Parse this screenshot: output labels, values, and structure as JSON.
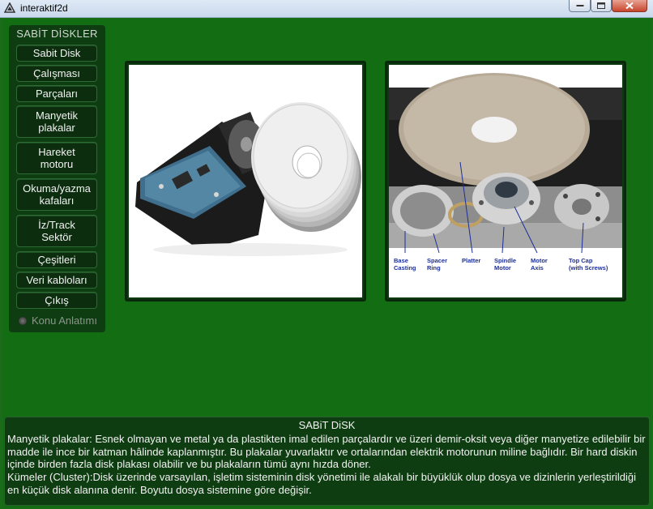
{
  "window": {
    "title": "interaktif2d"
  },
  "sidebar": {
    "title": "SABİT DİSKLER",
    "items": [
      {
        "label": "Sabit Disk"
      },
      {
        "label": "Çalışması"
      },
      {
        "label": "Parçaları"
      },
      {
        "label": "Manyetik\nplakalar"
      },
      {
        "label": "Hareket\nmotoru"
      },
      {
        "label": "Okuma/yazma\nkafaları"
      },
      {
        "label": "İz/Track\nSektör"
      },
      {
        "label": "Çeşitleri"
      },
      {
        "label": "Veri kabloları"
      },
      {
        "label": "Çıkış"
      }
    ],
    "radio_label": "Konu Anlatımı"
  },
  "right_image": {
    "labels": [
      "Base\nCasting",
      "Spacer\nRing",
      "Platter",
      "Spindle\nMotor",
      "Motor\nAxis",
      "Top Cap\n(with Screws)"
    ]
  },
  "info": {
    "title": "SABiT DiSK",
    "paragraphs": [
      "Manyetik plakalar: Esnek olmayan ve metal ya da plastikten imal edilen parçalardır ve üzeri demir-oksit veya diğer manyetize edilebilir bir madde ile ince bir katman hâlinde kaplanmıştır. Bu plakalar yuvarlaktır ve ortalarından elektrik motorunun miline bağlıdır. Bir hard diskin içinde birden fazla disk plakası olabilir ve bu plakaların tümü aynı hızda döner.",
      "Kümeler (Cluster):Disk üzerinde varsayılan, işletim sisteminin disk yönetimi ile alakalı bir büyüklük olup dosya ve dizinlerin yerleştirildiği en küçük disk alanına denir. Boyutu dosya sistemine göre değişir."
    ]
  },
  "colors": {
    "background": "#136d13",
    "panel": "#0f3d12",
    "button": "#0c2e0f",
    "text": "#f2f2f2",
    "label_blue": "#1d2f9a"
  }
}
